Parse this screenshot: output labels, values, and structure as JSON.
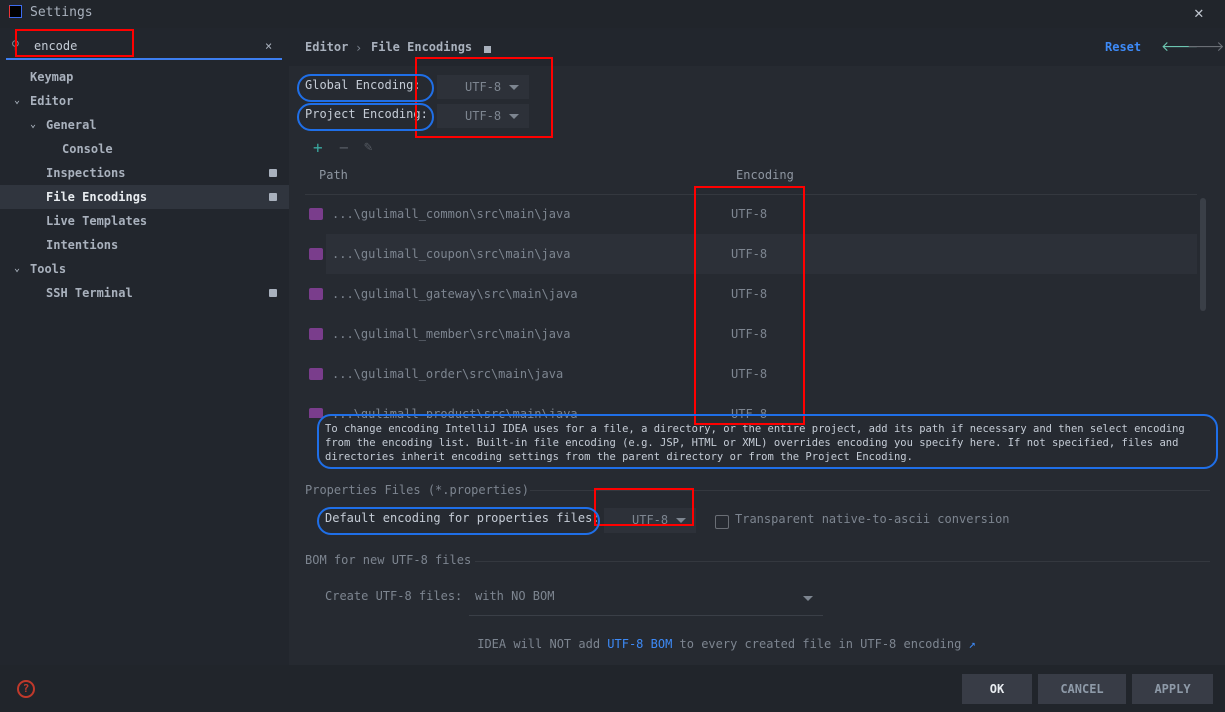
{
  "window": {
    "title": "Settings",
    "close_icon": "close-icon"
  },
  "search": {
    "value": "encode",
    "clear_icon": "close-icon"
  },
  "sidebar": {
    "items": [
      {
        "label": "Keymap"
      },
      {
        "label": "Editor",
        "expanded": true
      },
      {
        "label": "General",
        "expanded": true
      },
      {
        "label": "Console"
      },
      {
        "label": "Inspections",
        "badge": "project-icon"
      },
      {
        "label": "File Encodings",
        "badge": "project-icon",
        "selected": true
      },
      {
        "label": "Live Templates"
      },
      {
        "label": "Intentions"
      },
      {
        "label": "Tools",
        "expanded": true
      },
      {
        "label": "SSH Terminal",
        "badge": "project-icon"
      }
    ]
  },
  "header": {
    "breadcrumb": [
      "Editor",
      "File Encodings"
    ],
    "reset": "Reset"
  },
  "global_encoding": {
    "label": "Global Encoding:",
    "value": "UTF-8"
  },
  "project_encoding": {
    "label": "Project Encoding:",
    "value": "UTF-8"
  },
  "table": {
    "headers": [
      "Path",
      "Encoding"
    ],
    "rows": [
      {
        "path": "...\\gulimall_common\\src\\main\\java",
        "encoding": "UTF-8"
      },
      {
        "path": "...\\gulimall_coupon\\src\\main\\java",
        "encoding": "UTF-8"
      },
      {
        "path": "...\\gulimall_gateway\\src\\main\\java",
        "encoding": "UTF-8"
      },
      {
        "path": "...\\gulimall_member\\src\\main\\java",
        "encoding": "UTF-8"
      },
      {
        "path": "...\\gulimall_order\\src\\main\\java",
        "encoding": "UTF-8"
      },
      {
        "path": "...\\gulimall_product\\src\\main\\java",
        "encoding": "UTF-8"
      }
    ]
  },
  "info_text": "To change encoding IntelliJ IDEA uses for a file, a directory, or the entire project, add its path if necessary and then select encoding from the encoding list. Built-in file encoding (e.g. JSP, HTML or XML) overrides encoding you specify here. If not specified, files and directories inherit encoding settings from the parent directory or from the Project Encoding.",
  "properties": {
    "section": "Properties Files (*.properties)",
    "label": "Default encoding for properties files:",
    "value": "UTF-8",
    "checkbox_label": "Transparent native-to-ascii conversion",
    "checked": false
  },
  "bom": {
    "section": "BOM for new UTF-8 files",
    "label": "Create UTF-8 files:",
    "value": "with NO BOM",
    "note_before": "IDEA will NOT add ",
    "note_link": "UTF-8 BOM",
    "note_after": " to every created file in UTF-8 encoding"
  },
  "buttons": {
    "ok": "OK",
    "cancel": "CANCEL",
    "apply": "APPLY"
  },
  "colors": {
    "accent": "#3d8af7",
    "annotation_red": "#ff0000",
    "annotation_blue": "#1f6fe8"
  }
}
